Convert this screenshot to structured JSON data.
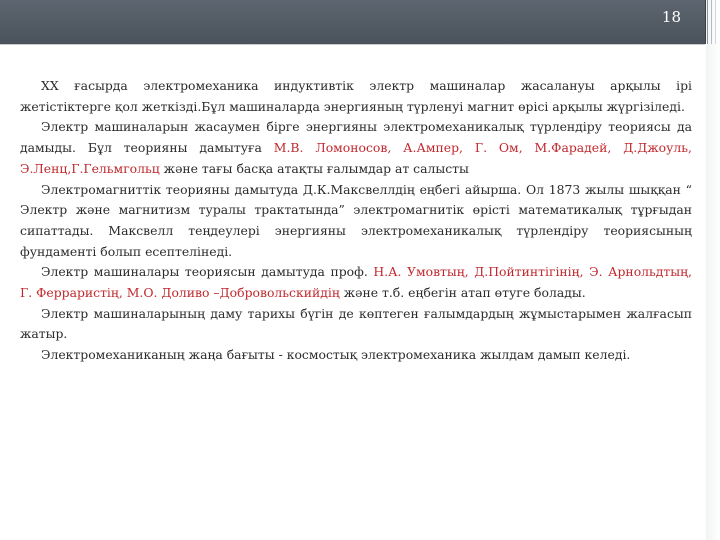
{
  "header": {
    "slide_number": "18"
  },
  "paragraphs": [
    {
      "text": "XX ғасырда электромеханика индуктивтік электр машиналар жасалануы арқылы ірі жетістіктерге қол жеткізді.Бұл машиналарда энергияның түрленуі магнит өрісі арқылы жүргізіледі."
    },
    {
      "text_before": "Электр машиналарын жасаумен бірге энергияны электромеханикалық түрлендіру теориясы да дамыды. Бұл теорияны дамытуға ",
      "names": "М.В. Ломоносов, А.Ампер, Г. Ом, М.Фарадей, Д.Джоуль, Э.Ленц,Г.Гельмгольц",
      "text_after": " және тағы басқа атақты ғалымдар ат салысты"
    },
    {
      "text": "Электромагниттік теорияны дамытуда Д.К.Максвеллдің еңбегі айырша. Ол 1873 жылы шыққан “ Электр және магнитизм туралы трактатында” электромагнитік өрісті математикалық тұрғыдан сипаттады. Максвелл теңдеулері энергияны электромеханикалық түрлендіру теориясының фундаменті болып есептелінеді."
    },
    {
      "text_before": "Электр машиналары теориясын дамытуда проф. ",
      "names": "Н.А. Умовтың, Д.Пойтинтігінің, Э. Арнольдтың, Г. Ферраристің, М.О. Доливо –Добровольскийдің",
      "text_after": " және т.б. еңбегін атап өтуге болады."
    },
    {
      "text": "Электр машиналарының даму тарихы бүгін де көптеген ғалымдардың жұмыстарымен жалғасып жатыр."
    },
    {
      "text": "Электромеханиканың жаңа бағыты - космостық электромеханика жылдам дамып келеді."
    }
  ],
  "colors": {
    "header_bar": "#525a63",
    "text": "#2b2b2b",
    "highlight": "#c0282d"
  }
}
